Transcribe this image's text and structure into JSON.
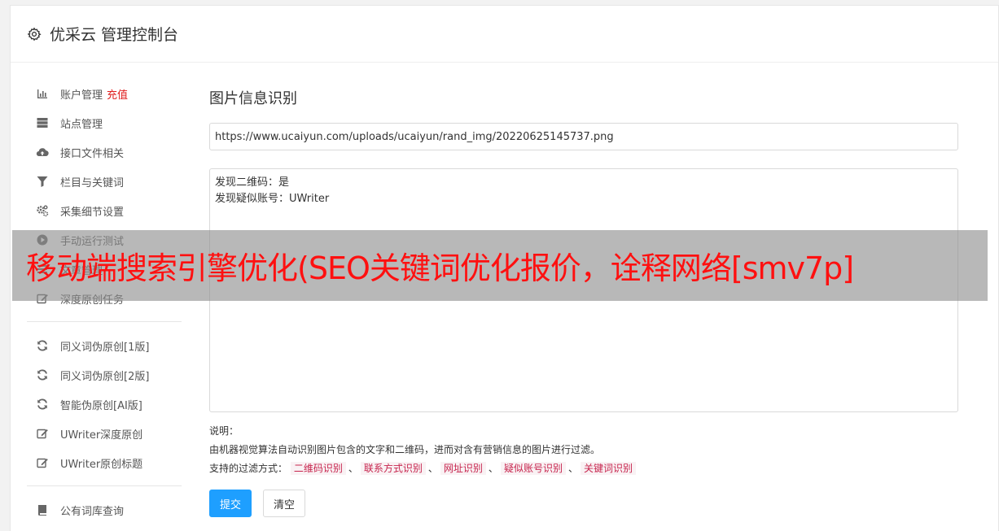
{
  "header": {
    "title": "优采云 管理控制台"
  },
  "sidebar": {
    "groups": [
      [
        {
          "label": "账户管理",
          "extra": "充值",
          "icon": "bar-chart-icon"
        },
        {
          "label": "站点管理",
          "icon": "server-icon"
        },
        {
          "label": "接口文件相关",
          "icon": "cloud-upload-icon"
        },
        {
          "label": "栏目与关键词",
          "icon": "filter-icon"
        },
        {
          "label": "采集细节设置",
          "icon": "cogs-icon"
        },
        {
          "label": "手动运行测试",
          "icon": "play-circle-icon"
        },
        {
          "label": "文章管理",
          "icon": "list-icon"
        },
        {
          "label": "深度原创任务",
          "icon": "edit-icon"
        }
      ],
      [
        {
          "label": "同义词伪原创[1版]",
          "icon": "refresh-icon"
        },
        {
          "label": "同义词伪原创[2版]",
          "icon": "refresh-icon"
        },
        {
          "label": "智能伪原创[AI版]",
          "icon": "refresh-icon"
        },
        {
          "label": "UWriter深度原创",
          "icon": "edit-icon"
        },
        {
          "label": "UWriter原创标题",
          "icon": "edit-icon"
        }
      ],
      [
        {
          "label": "公有词库查询",
          "icon": "book-icon"
        }
      ]
    ]
  },
  "main": {
    "title": "图片信息识别",
    "url_value": "https://www.ucaiyun.com/uploads/ucaiyun/rand_img/20220625145737.png",
    "result_text": "发现二维码：是\n发现疑似账号：UWriter",
    "note_label": "说明：",
    "note_desc": "由机器视觉算法自动识别图片包含的文字和二维码，进而对含有营销信息的图片进行过滤。",
    "filter_label": "支持的过滤方式：",
    "filters": [
      "二维码识别",
      "联系方式识别",
      "网址识别",
      "疑似账号识别",
      "关键词识别"
    ],
    "separator": "、",
    "submit_label": "提交",
    "clear_label": "清空"
  },
  "overlay": {
    "text": "移动端搜索引擎优化(SEO关键词优化报价，诠释网络[smv7p]"
  },
  "colors": {
    "primary": "#1e9fff",
    "danger": "#e02020",
    "tag": "#c7254e"
  }
}
